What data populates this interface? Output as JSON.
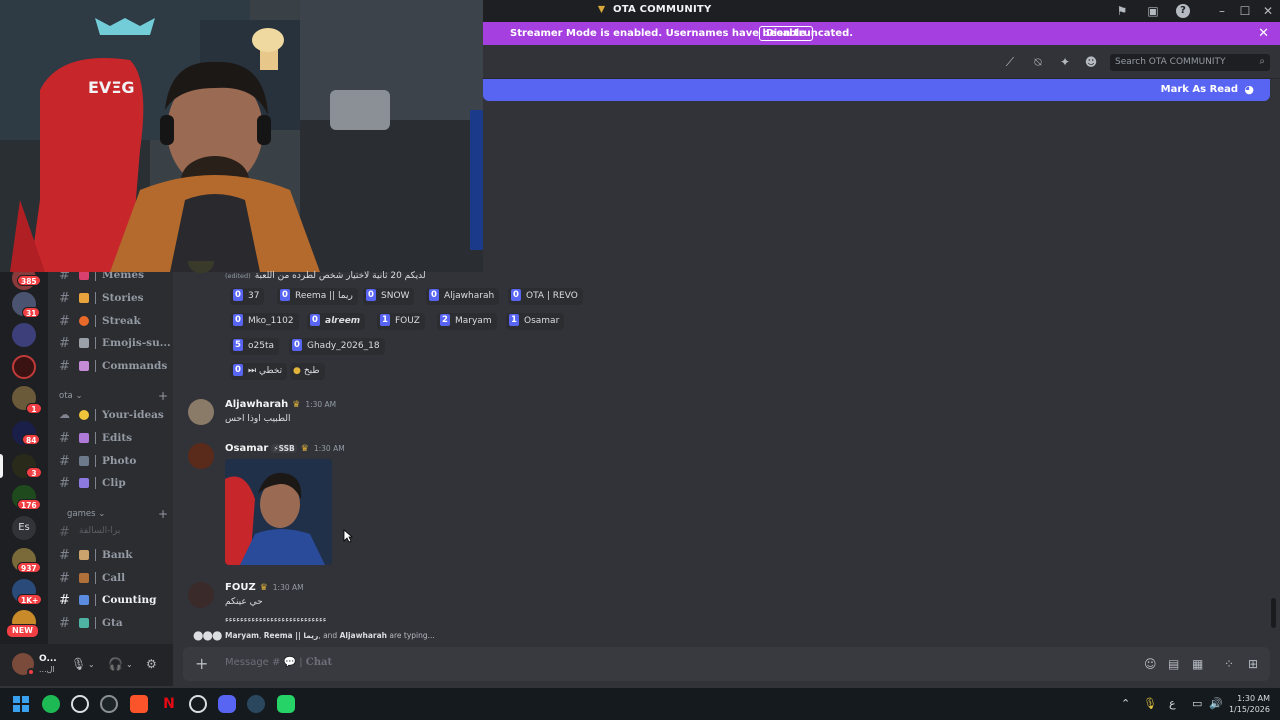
{
  "window": {
    "title": "OTA COMMUNITY"
  },
  "banner": {
    "message": "Streamer Mode is enabled. Usernames have been truncated.",
    "disable_label": "Disable"
  },
  "toolbar": {
    "search_placeholder": "Search OTA COMMUNITY"
  },
  "new_messages": {
    "mark_label": "Mark As Read"
  },
  "servers": {
    "badges": [
      "385",
      "31",
      "1",
      "84",
      "3",
      "176",
      "937",
      "1K+"
    ],
    "text_server": "Es",
    "new_label": "NEW"
  },
  "channels": {
    "top": [
      {
        "name": "Memes",
        "emoji_color": "#d9406e"
      },
      {
        "name": "Stories",
        "emoji_color": "#e8a33d"
      },
      {
        "name": "Streak",
        "emoji_color": "#e86a2b"
      },
      {
        "name": "Emojis-su...",
        "emoji_color": "#9aa0a8"
      },
      {
        "name": "Commands",
        "emoji_color": "#c58bd6"
      }
    ],
    "ota_category": "OTA",
    "ota": [
      {
        "name": "Your-ideas",
        "emoji_color": "#f0c43a",
        "icon": "bubbles"
      },
      {
        "name": "Edits",
        "emoji_color": "#b07ad9"
      },
      {
        "name": "Photo",
        "emoji_color": "#6c7a8c"
      },
      {
        "name": "Clip",
        "emoji_color": "#8d7ae0"
      }
    ],
    "games_category": "games",
    "games": [
      {
        "name": "برا-السالفة",
        "emoji_color": "#80848e"
      },
      {
        "name": "Bank",
        "emoji_color": "#c9a36b"
      },
      {
        "name": "Call",
        "emoji_color": "#b0703a"
      },
      {
        "name": "Counting",
        "emoji_color": "#5a8de0",
        "active": true
      },
      {
        "name": "Gta",
        "emoji_color": "#4fb3a3"
      }
    ]
  },
  "user": {
    "name": "O...",
    "status": "...ال"
  },
  "messages": {
    "first_text": "لديكم 20 ثانية لاختيار شخص لطرده من اللعبة",
    "edited": "(edited)",
    "reactions": [
      {
        "count": "0",
        "label": "37"
      },
      {
        "count": "0",
        "label": "Reema || ريما"
      },
      {
        "count": "0",
        "label": "SNOW"
      },
      {
        "count": "0",
        "label": "Aljawharah"
      },
      {
        "count": "0",
        "label": "OTA | REVO"
      },
      {
        "count": "0",
        "label": "Mko_1102"
      },
      {
        "count": "0",
        "label": "𝙖𝙡𝙧𝙚𝙚𝙢"
      },
      {
        "count": "1",
        "label": "FOUZ"
      },
      {
        "count": "2",
        "label": "Maryam"
      },
      {
        "count": "1",
        "label": "Osamar"
      },
      {
        "count": "5",
        "label": "o25ta"
      },
      {
        "count": "0",
        "label": "Ghady_2026_18"
      },
      {
        "count": "0",
        "label": "⏭ تخطي"
      },
      {
        "count": "",
        "label": "طبخ"
      }
    ],
    "m2": {
      "author": "Aljawharah",
      "time": "1:30 AM",
      "text": "الطبيب اوذا احس"
    },
    "m3": {
      "author": "Osamar",
      "tag": "⚡SSB",
      "time": "1:30 AM"
    },
    "m4": {
      "author": "FOUZ",
      "time": "1:30 AM",
      "text": "حي عينكم",
      "text2": "ءءءءءءءءءءءءءءءءءءءءءءءءءءء"
    },
    "typing_names_1": "Maryam",
    "typing_names_2": "Reema || ريما",
    "typing_and": ", and",
    "typing_names_3": "Aljawharah",
    "typing_suffix": "are typing..."
  },
  "composer": {
    "placeholder": "Message #",
    "channel_suffix": "Chat"
  },
  "clock": {
    "time": "1:30 AM",
    "date": "1/15/2026",
    "lang": "ع"
  }
}
